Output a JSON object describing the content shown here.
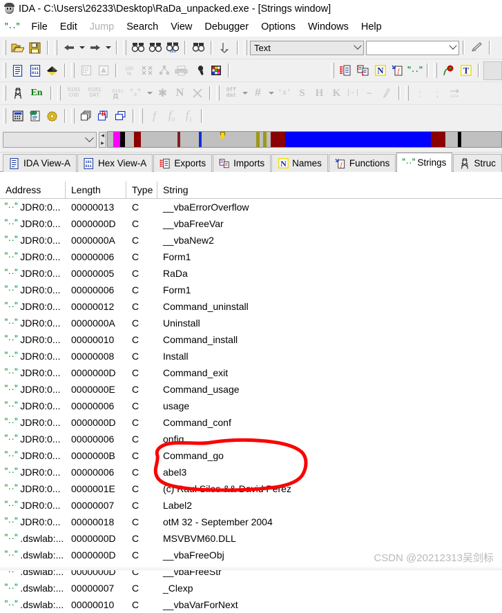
{
  "window": {
    "title": "IDA - C:\\Users\\26233\\Desktop\\RaDa_unpacked.exe - [Strings window]",
    "icon": "ida-app-icon"
  },
  "menu": {
    "strings_icon": "\"..\"",
    "items": [
      {
        "label": "File",
        "disabled": false
      },
      {
        "label": "Edit",
        "disabled": false
      },
      {
        "label": "Jump",
        "disabled": true
      },
      {
        "label": "Search",
        "disabled": false
      },
      {
        "label": "View",
        "disabled": false
      },
      {
        "label": "Debugger",
        "disabled": false
      },
      {
        "label": "Options",
        "disabled": false
      },
      {
        "label": "Windows",
        "disabled": false
      },
      {
        "label": "Help",
        "disabled": false
      }
    ]
  },
  "toolbar": {
    "row1": {
      "open_label": "Open file",
      "save_label": "Save database",
      "back_label": "Jump backward",
      "forward_label": "Jump forward",
      "search_label": "Search",
      "search_again_label": "Search again",
      "search_hex_label": "Binary search",
      "search_sub_label": "Search in subviews",
      "jump_label": "Jump to entry point",
      "text_combo_value": "Text",
      "filter_combo_value": "",
      "highlight_label": "Highlight"
    },
    "row2": {
      "list_label": "Open subviews",
      "hex_label": "Hex view",
      "graph_label": "Graph view",
      "grid_label": "Show flowchart",
      "struct_label": "Show structures",
      "percent_label": "Percent",
      "collapse_label": "Collapse",
      "xrefs_label": "Cross references",
      "print_label": "Print",
      "tools_label": "Tools",
      "colors_label": "Colors",
      "exports_label": "Exports",
      "imports_label": "Imports",
      "names_label": "Names",
      "functions_label": "Functions",
      "strings_label": "Strings",
      "flower_label": "Decompile",
      "type_label": "Type"
    },
    "row3": {
      "struct_label": "Structures",
      "enum_label": "En",
      "code_label": "0101 COD",
      "data_label": "0101 DAT",
      "struct2_label": "0101",
      "string_label": "\"s\"",
      "array_label": "*",
      "name_label": "N",
      "undefine_label": "X",
      "offset_label": "Off dat",
      "number_label": "#",
      "char_label": "'x'",
      "segment_label": "S",
      "hex_label": "H",
      "stack_label": "K",
      "func_label": "f-l",
      "wave_label": "~",
      "edit_label": "Edit",
      "colon_label": ":",
      "semicolon_label": ";",
      "align_label": "align"
    },
    "row4": {
      "calc_label": "Calculator",
      "patch_label": "Patch program",
      "gear_label": "Plugins",
      "windows_label": "Tile windows",
      "reset_label": "Reset desktop",
      "cascade_label": "Cascade",
      "fn_label": "f",
      "fn0_label": "f0",
      "fn1_label": "f1"
    }
  },
  "navigation": {
    "combo_value": "",
    "band_segments": [
      {
        "color": "#c0c0c0",
        "width": 1.5
      },
      {
        "color": "#ff00ff",
        "width": 2.0
      },
      {
        "color": "#000000",
        "width": 1.2
      },
      {
        "color": "#c0c0c0",
        "width": 2.5
      },
      {
        "color": "#8b0000",
        "width": 2.0
      },
      {
        "color": "#c0c0c0",
        "width": 10.0
      },
      {
        "color": "#8b1a1a",
        "width": 0.8
      },
      {
        "color": "#c0c0c0",
        "width": 5.0
      },
      {
        "color": "#1030d0",
        "width": 0.8
      },
      {
        "color": "#c0c0c0",
        "width": 15.0
      },
      {
        "color": "#9a9a1a",
        "width": 0.9
      },
      {
        "color": "#c0c0c0",
        "width": 1.0
      },
      {
        "color": "#9a9a1a",
        "width": 0.9
      },
      {
        "color": "#c0c0c0",
        "width": 1.2
      },
      {
        "color": "#8b0000",
        "width": 4.0
      },
      {
        "color": "#0000ff",
        "width": 40.0
      },
      {
        "color": "#8b0000",
        "width": 4.0
      },
      {
        "color": "#c0c0c0",
        "width": 3.5
      },
      {
        "color": "#000000",
        "width": 0.9
      },
      {
        "color": "#c0c0c0",
        "width": 11.0
      }
    ],
    "cursor_pos_pct": 28.5
  },
  "tabs": [
    {
      "label": "IDA View-A",
      "icon": "ida-view-icon",
      "active": false
    },
    {
      "label": "Hex View-A",
      "icon": "hex-view-icon",
      "active": false
    },
    {
      "label": "Exports",
      "icon": "exports-icon",
      "active": false
    },
    {
      "label": "Imports",
      "icon": "imports-icon",
      "active": false
    },
    {
      "label": "Names",
      "icon": "names-icon",
      "active": false
    },
    {
      "label": "Functions",
      "icon": "functions-icon",
      "active": false
    },
    {
      "label": "Strings",
      "icon": "strings-icon",
      "active": true
    },
    {
      "label": "Struc",
      "icon": "structures-icon",
      "active": false
    }
  ],
  "table": {
    "columns": [
      "Address",
      "Length",
      "Type",
      "String"
    ],
    "row_icon": "\"..\"",
    "rows": [
      {
        "address": "JDR0:0...",
        "length": "00000013",
        "type": "C",
        "string": "__vbaErrorOverflow"
      },
      {
        "address": "JDR0:0...",
        "length": "0000000D",
        "type": "C",
        "string": "__vbaFreeVar"
      },
      {
        "address": "JDR0:0...",
        "length": "0000000A",
        "type": "C",
        "string": "__vbaNew2"
      },
      {
        "address": "JDR0:0...",
        "length": "00000006",
        "type": "C",
        "string": "Form1"
      },
      {
        "address": "JDR0:0...",
        "length": "00000005",
        "type": "C",
        "string": "RaDa"
      },
      {
        "address": "JDR0:0...",
        "length": "00000006",
        "type": "C",
        "string": "Form1"
      },
      {
        "address": "JDR0:0...",
        "length": "00000012",
        "type": "C",
        "string": "Command_uninstall"
      },
      {
        "address": "JDR0:0...",
        "length": "0000000A",
        "type": "C",
        "string": "Uninstall"
      },
      {
        "address": "JDR0:0...",
        "length": "00000010",
        "type": "C",
        "string": "Command_install"
      },
      {
        "address": "JDR0:0...",
        "length": "00000008",
        "type": "C",
        "string": "Install"
      },
      {
        "address": "JDR0:0...",
        "length": "0000000D",
        "type": "C",
        "string": "Command_exit"
      },
      {
        "address": "JDR0:0...",
        "length": "0000000E",
        "type": "C",
        "string": "Command_usage"
      },
      {
        "address": "JDR0:0...",
        "length": "00000006",
        "type": "C",
        "string": "usage"
      },
      {
        "address": "JDR0:0...",
        "length": "0000000D",
        "type": "C",
        "string": "Command_conf"
      },
      {
        "address": "JDR0:0...",
        "length": "00000006",
        "type": "C",
        "string": "onfig"
      },
      {
        "address": "JDR0:0...",
        "length": "0000000B",
        "type": "C",
        "string": "Command_go"
      },
      {
        "address": "JDR0:0...",
        "length": "00000006",
        "type": "C",
        "string": "abel3"
      },
      {
        "address": "JDR0:0...",
        "length": "0000001E",
        "type": "C",
        "string": "(c) Raul Siles && David Perez"
      },
      {
        "address": "JDR0:0...",
        "length": "00000007",
        "type": "C",
        "string": "Label2"
      },
      {
        "address": "JDR0:0...",
        "length": "00000018",
        "type": "C",
        "string": "otM 32 - September 2004"
      },
      {
        "address": ".dswlab:...",
        "length": "0000000D",
        "type": "C",
        "string": "MSVBVM60.DLL"
      },
      {
        "address": ".dswlab:...",
        "length": "0000000D",
        "type": "C",
        "string": "__vbaFreeObj"
      },
      {
        "address": ".dswlab:...",
        "length": "0000000D",
        "type": "C",
        "string": "__vbaFreeStr"
      },
      {
        "address": ".dswlab:...",
        "length": "00000007",
        "type": "C",
        "string": "_Clexp"
      },
      {
        "address": ".dswlab:...",
        "length": "00000010",
        "type": "C",
        "string": "__vbaVarForNext"
      }
    ]
  },
  "annotation": {
    "color": "#fb0303",
    "highlighted_row_index": 17,
    "highlighted_text": "(c) Raul Siles && David Perez"
  },
  "watermark": {
    "text": "CSDN @20212313吴剑标"
  }
}
